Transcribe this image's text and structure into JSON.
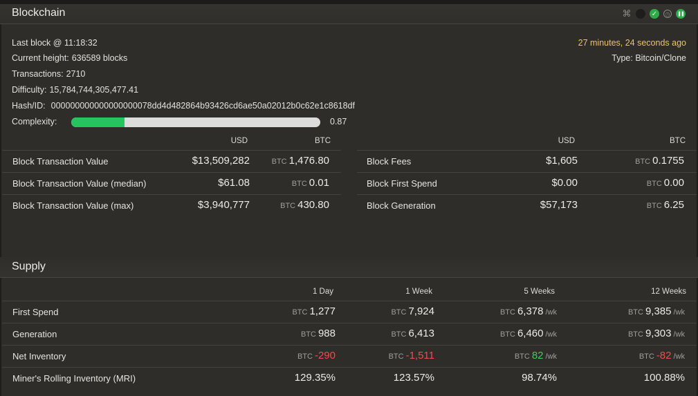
{
  "blockchain": {
    "title": "Blockchain",
    "icons": [
      "network-icon",
      "status-dark-icon",
      "check-icon",
      "history-icon",
      "pause-icon"
    ],
    "last_block_label": "Last block @ 11:18:32",
    "ago": "27 minutes, 24 seconds ago",
    "type_label": "Type:",
    "type_value": "Bitcoin/Clone",
    "height_label": "Current height:",
    "height_value": "636589 blocks",
    "tx_label": "Transactions:",
    "tx_value": "2710",
    "difficulty_label": "Difficulty:",
    "difficulty_value": "15,784,744,305,477.41",
    "hash_label": "Hash/ID:",
    "hash_value": "000000000000000000078dd4d482864b93426cd6ae50a02012b0c62e1c8618df",
    "complexity_label": "Complexity:",
    "complexity_value": "0.87",
    "complexity_fraction": 0.215
  },
  "block_values": {
    "col_usd": "USD",
    "col_btc": "BTC",
    "unit": "BTC",
    "left": [
      {
        "label": "Block Transaction Value",
        "usd": "$13,509,282",
        "btc": "1,476.80"
      },
      {
        "label": "Block Transaction Value (median)",
        "usd": "$61.08",
        "btc": "0.01"
      },
      {
        "label": "Block Transaction Value (max)",
        "usd": "$3,940,777",
        "btc": "430.80"
      }
    ],
    "right": [
      {
        "label": "Block Fees",
        "usd": "$1,605",
        "btc": "0.1755"
      },
      {
        "label": "Block First Spend",
        "usd": "$0.00",
        "btc": "0.00"
      },
      {
        "label": "Block Generation",
        "usd": "$57,173",
        "btc": "6.25"
      }
    ]
  },
  "supply": {
    "title": "Supply",
    "columns": [
      "1 Day",
      "1 Week",
      "5 Weeks",
      "12 Weeks"
    ],
    "unit": "BTC",
    "per_week": "/wk",
    "rows": [
      {
        "label": "First Spend",
        "cells": [
          "1,277",
          "7,924",
          "6,378",
          "9,385"
        ]
      },
      {
        "label": "Generation",
        "cells": [
          "988",
          "6,413",
          "6,460",
          "9,303"
        ]
      },
      {
        "label": "Net Inventory",
        "cells": [
          "-290",
          "-1,511",
          "82",
          "-82"
        ]
      },
      {
        "label": "Miner's Rolling Inventory (MRI)",
        "cells": [
          "129.35%",
          "123.57%",
          "98.74%",
          "100.88%"
        ]
      }
    ]
  },
  "colors": {
    "accent_green": "#25c45c",
    "negative": "#ef4d4d",
    "positive": "#39d05a",
    "ago": "#e9c46a"
  }
}
